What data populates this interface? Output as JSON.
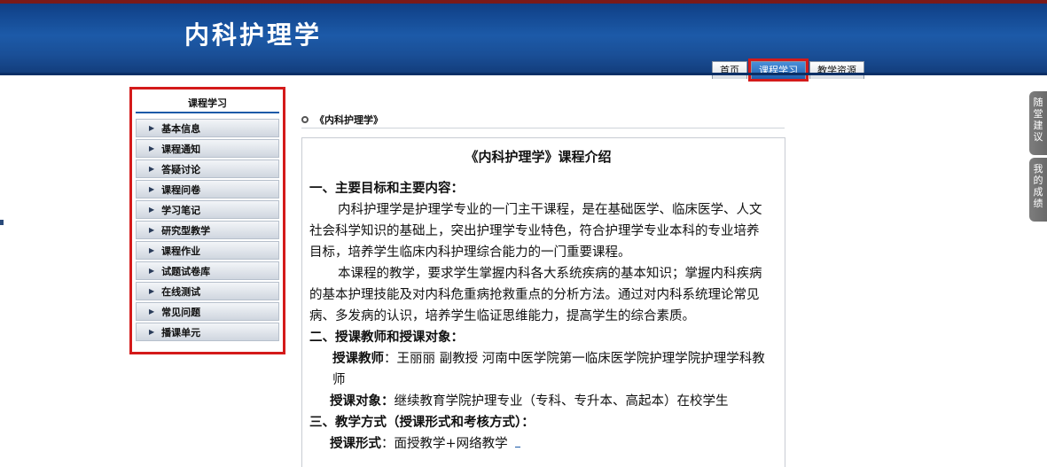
{
  "header": {
    "site_title": "内科护理学",
    "nav": [
      "首页",
      "课程学习",
      "教学资源"
    ]
  },
  "sidebar": {
    "title": "课程学习",
    "items": [
      "基本信息",
      "课程通知",
      "答疑讨论",
      "课程问卷",
      "学习笔记",
      "研究型教学",
      "课程作业",
      "试题试卷库",
      "在线测试",
      "常见问题",
      "播课单元"
    ]
  },
  "main": {
    "breadcrumb": "《内科护理学》",
    "content": {
      "title": "《内科护理学》课程介绍",
      "section1_heading": "一、主要目标和主要内容：",
      "section1_p1": "内科护理学是护理学专业的一门主干课程，是在基础医学、临床医学、人文社会科学知识的基础上，突出护理学专业特色，符合护理学专业本科的专业培养目标，培养学生临床内科护理综合能力的一门重要课程。",
      "section1_p2": "本课程的教学，要求学生掌握内科各大系统疾病的基本知识；掌握内科疾病的基本护理技能及对内科危重病抢救重点的分析方法。通过对内科系统理论常见病、多发病的认识，培养学生临证思维能力，提高学生的综合素质。",
      "section2_heading": "二、授课教师和授课对象：",
      "teacher_label": "授课教师",
      "teacher_value": "：王丽丽  副教授  河南中医学院第一临床医学院护理学院护理学科教师",
      "target_label": "授课对象：",
      "target_value": "继续教育学院护理专业（专科、专升本、高起本）在校学生",
      "section3_heading": "三、教学方式（授课形式和考核方式）：",
      "form_label": "授课形式",
      "form_value": "：面授教学+网络教学"
    }
  },
  "floating": {
    "suggest": "随堂建议",
    "grades": "我的成绩"
  }
}
